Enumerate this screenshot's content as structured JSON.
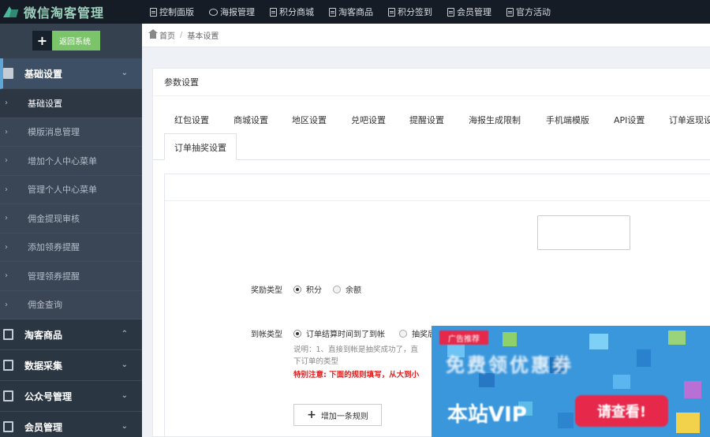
{
  "app": {
    "logo_text": "微信淘客管理"
  },
  "topnav": [
    {
      "label": "控制面版",
      "icon": "doc-icon"
    },
    {
      "label": "海报管理",
      "icon": "chat-icon"
    },
    {
      "label": "积分商城",
      "icon": "doc-icon"
    },
    {
      "label": "淘客商品",
      "icon": "doc-icon"
    },
    {
      "label": "积分签到",
      "icon": "doc-icon"
    },
    {
      "label": "会员管理",
      "icon": "doc-icon"
    },
    {
      "label": "官方活动",
      "icon": "doc-icon"
    }
  ],
  "sidebar": {
    "back_label": "返回系统",
    "group_basic": {
      "label": "基础设置"
    },
    "basic_items": [
      {
        "label": "基础设置"
      },
      {
        "label": "模版消息管理"
      },
      {
        "label": "增加个人中心菜单"
      },
      {
        "label": "管理个人中心菜单"
      },
      {
        "label": "佣金提现审核"
      },
      {
        "label": "添加领券提醒"
      },
      {
        "label": "管理领券提醒"
      },
      {
        "label": "佣金查询"
      }
    ],
    "group_goods": {
      "label": "淘客商品"
    },
    "group_collect": {
      "label": "数据采集"
    },
    "group_wechat": {
      "label": "公众号管理"
    },
    "group_member": {
      "label": "会员管理"
    }
  },
  "breadcrumb": {
    "home": "首页",
    "sep": "/",
    "current": "基本设置"
  },
  "panel": {
    "title": "参数设置",
    "tabs": [
      {
        "label": "红包设置"
      },
      {
        "label": "商城设置"
      },
      {
        "label": "地区设置"
      },
      {
        "label": "兑吧设置"
      },
      {
        "label": "提醒设置"
      },
      {
        "label": "海报生成限制"
      },
      {
        "label": "手机端模版"
      },
      {
        "label": "API设置"
      },
      {
        "label": "订单返现设"
      },
      {
        "label": "订单抽奖设置"
      }
    ]
  },
  "form": {
    "reward_type": {
      "label": "奖励类型",
      "options": [
        "积分",
        "余额"
      ],
      "selected": "积分"
    },
    "arrival_type": {
      "label": "到帐类型",
      "options": [
        "订单结算时间到了到帐",
        "抽奖后"
      ],
      "selected": "订单结算时间到了到帐"
    },
    "note_line1": "说明：1、直接到帐是抽奖成功了，直",
    "note_line2": "下订单的类型",
    "warn": "特别注意: 下面的规则填写，从大到小",
    "add_rule_label": "增加一条规则"
  },
  "ad": {
    "tag": "广告推荐",
    "line1": "免费领优惠券",
    "line2": "本站VIP",
    "badge": "请查看!"
  }
}
